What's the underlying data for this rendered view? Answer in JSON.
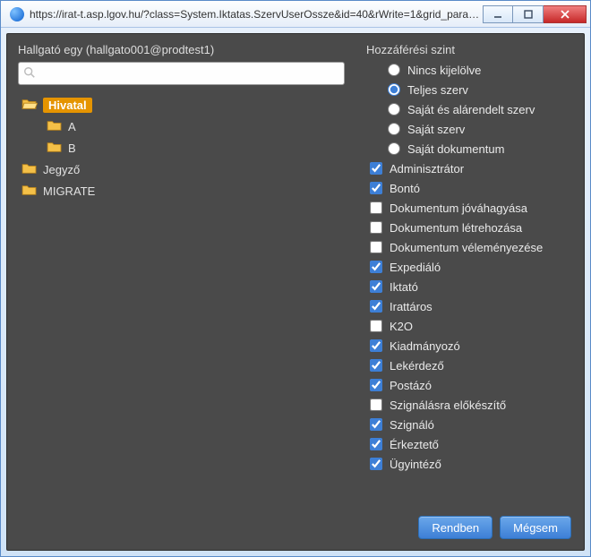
{
  "window": {
    "title": "https://irat-t.asp.lgov.hu/?class=System.Iktatas.SzervUserOssze&id=40&rWrite=1&grid_params..."
  },
  "user_label": "Hallgató egy (hallgato001@prodtest1)",
  "search": {
    "placeholder": ""
  },
  "tree": {
    "items": [
      {
        "label": "Hivatal",
        "indent": 0,
        "selected": true,
        "open": true
      },
      {
        "label": "A",
        "indent": 1,
        "selected": false,
        "open": false
      },
      {
        "label": "B",
        "indent": 1,
        "selected": false,
        "open": false
      },
      {
        "label": "Jegyző",
        "indent": 0,
        "selected": false,
        "open": false
      },
      {
        "label": "MIGRATE",
        "indent": 0,
        "selected": false,
        "open": false
      }
    ]
  },
  "access": {
    "title": "Hozzáférési szint",
    "options": [
      {
        "label": "Nincs kijelölve",
        "checked": false
      },
      {
        "label": "Teljes szerv",
        "checked": true
      },
      {
        "label": "Saját és alárendelt szerv",
        "checked": false
      },
      {
        "label": "Saját szerv",
        "checked": false
      },
      {
        "label": "Saját dokumentum",
        "checked": false
      }
    ]
  },
  "roles": [
    {
      "label": "Adminisztrátor",
      "checked": true
    },
    {
      "label": "Bontó",
      "checked": true
    },
    {
      "label": "Dokumentum jóváhagyása",
      "checked": false
    },
    {
      "label": "Dokumentum létrehozása",
      "checked": false
    },
    {
      "label": "Dokumentum véleményezése",
      "checked": false
    },
    {
      "label": "Expediáló",
      "checked": true
    },
    {
      "label": "Iktató",
      "checked": true
    },
    {
      "label": "Irattáros",
      "checked": true
    },
    {
      "label": "K2O",
      "checked": false
    },
    {
      "label": "Kiadmányozó",
      "checked": true
    },
    {
      "label": "Lekérdező",
      "checked": true
    },
    {
      "label": "Postázó",
      "checked": true
    },
    {
      "label": "Szignálásra előkészítő",
      "checked": false
    },
    {
      "label": "Szignáló",
      "checked": true
    },
    {
      "label": "Érkeztető",
      "checked": true
    },
    {
      "label": "Ügyintéző",
      "checked": true
    }
  ],
  "buttons": {
    "ok": "Rendben",
    "cancel": "Mégsem"
  }
}
